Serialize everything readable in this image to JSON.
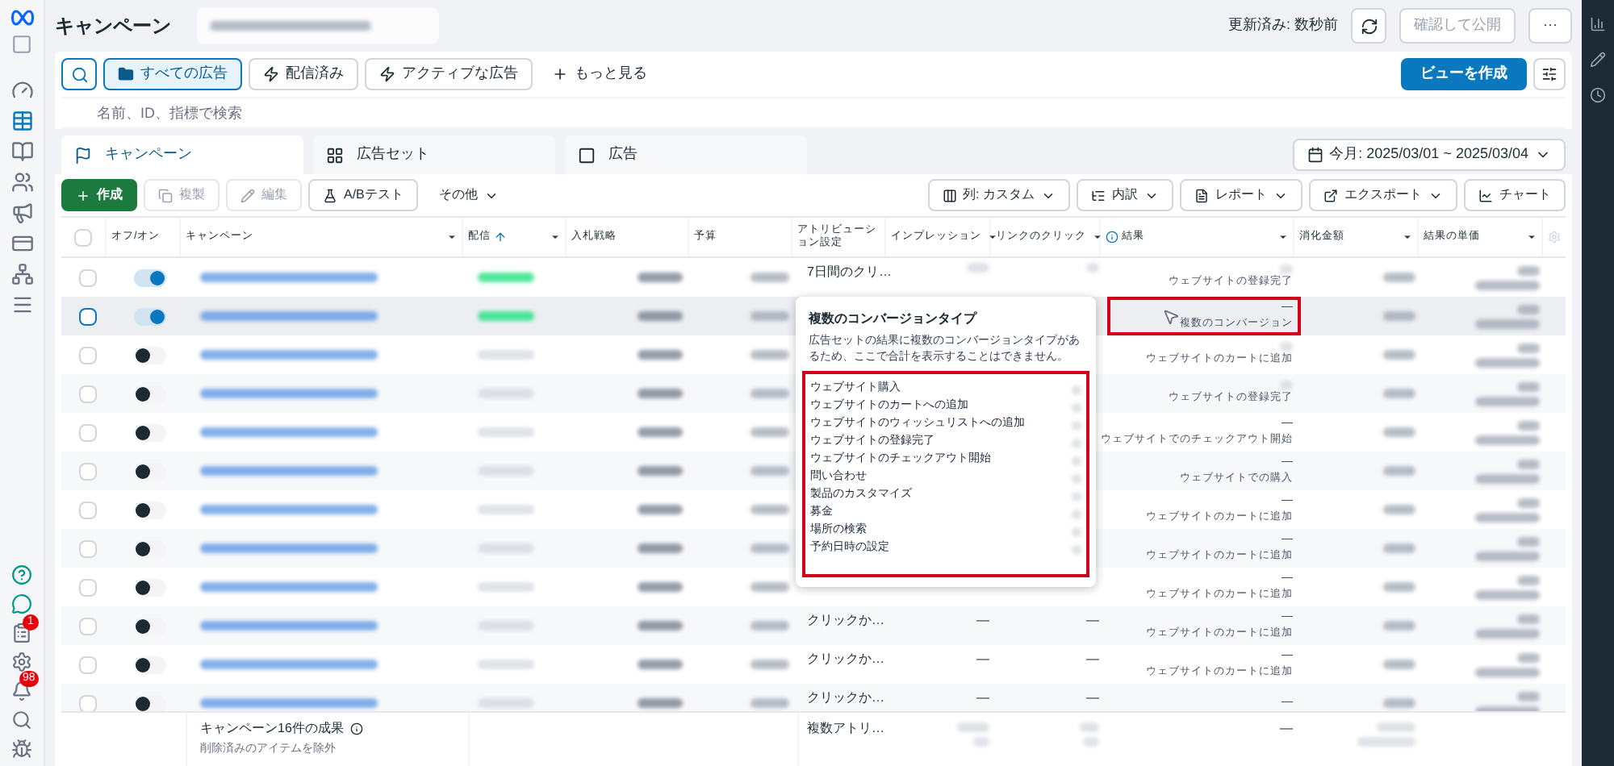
{
  "header": {
    "title": "キャンペーン",
    "updated": "更新済み: 数秒前",
    "publish_button": "確認して公開",
    "more_button": "···"
  },
  "filters": [
    {
      "label": "すべての広告",
      "selected": true,
      "kind": "folder"
    },
    {
      "label": "配信済み",
      "selected": false,
      "kind": "bolt"
    },
    {
      "label": "アクティブな広告",
      "selected": false,
      "kind": "bolt"
    }
  ],
  "more_filters": "もっと見る",
  "create_view": "ビューを作成",
  "search": {
    "placeholder": "名前、ID、指標で検索"
  },
  "tabs": [
    {
      "label": "キャンペーン",
      "selected": true,
      "kind": "campaign"
    },
    {
      "label": "広告セット",
      "selected": false,
      "kind": "adset"
    },
    {
      "label": "広告",
      "selected": false,
      "kind": "ad"
    }
  ],
  "date_range": "今月: 2025/03/01 ~ 2025/03/04",
  "toolbar_left": [
    {
      "label": "作成",
      "kind": "create",
      "disabled": false
    },
    {
      "label": "複製",
      "kind": "duplicate",
      "disabled": true
    },
    {
      "label": "編集",
      "kind": "edit",
      "disabled": true
    },
    {
      "label": "A/Bテスト",
      "kind": "abtest",
      "disabled": false
    },
    {
      "label": "その他",
      "kind": "other",
      "disabled": false
    }
  ],
  "toolbar_right": [
    {
      "label": "列: カスタム",
      "kind": "columns"
    },
    {
      "label": "内訳",
      "kind": "breakdown"
    },
    {
      "label": "レポート",
      "kind": "reports"
    },
    {
      "label": "エクスポート",
      "kind": "export"
    },
    {
      "label": "チャート",
      "kind": "chart"
    }
  ],
  "all_checked": false,
  "columns": [
    {
      "label": "オフ/オン",
      "dropdown": false,
      "sorted": false,
      "info": false
    },
    {
      "label": "キャンペーン",
      "dropdown": true,
      "sorted": false,
      "info": false
    },
    {
      "label": "配信",
      "dropdown": true,
      "sorted": true,
      "info": false
    },
    {
      "label": "入札戦略",
      "dropdown": false,
      "sorted": false,
      "info": false
    },
    {
      "label": "予算",
      "dropdown": false,
      "sorted": false,
      "info": false
    },
    {
      "label": "アトリビューション設定",
      "dropdown": false,
      "sorted": false,
      "info": false
    },
    {
      "label": "インプレッション",
      "dropdown": true,
      "sorted": false,
      "info": false
    },
    {
      "label": "リンクのクリック",
      "dropdown": true,
      "sorted": false,
      "info": false
    },
    {
      "label": "結果",
      "dropdown": true,
      "sorted": false,
      "info": true
    },
    {
      "label": "消化金額",
      "dropdown": true,
      "sorted": false,
      "info": false
    },
    {
      "label": "結果の単価",
      "dropdown": true,
      "sorted": false,
      "info": false
    }
  ],
  "rows": [
    {
      "checked": false,
      "on": true,
      "attribution": "7日間のクリ…",
      "result_type": "ウェブサイトの登録完了",
      "highlighted": false
    },
    {
      "checked": false,
      "on": true,
      "result": "—",
      "result_type": "複数のコンバージョン",
      "highlighted": true
    },
    {
      "checked": false,
      "on": false,
      "result_type": "ウェブサイトのカートに追加",
      "highlighted": false
    },
    {
      "checked": false,
      "on": false,
      "result_type": "ウェブサイトの登録完了",
      "highlighted": false
    },
    {
      "checked": false,
      "on": false,
      "result": "—",
      "result_type": "ウェブサイトでのチェックアウト開始",
      "highlighted": false
    },
    {
      "checked": false,
      "on": false,
      "result": "—",
      "result_type": "ウェブサイトでの購入",
      "highlighted": false
    },
    {
      "checked": false,
      "on": false,
      "result": "—",
      "result_type": "ウェブサイトのカートに追加",
      "highlighted": false
    },
    {
      "checked": false,
      "on": false,
      "result": "—",
      "result_type": "ウェブサイトのカートに追加",
      "highlighted": false
    },
    {
      "checked": false,
      "on": false,
      "result": "—",
      "result_type": "ウェブサイトのカートに追加",
      "highlighted": false
    },
    {
      "checked": false,
      "on": false,
      "attribution": "クリックか…",
      "impressions": "—",
      "clicks": "—",
      "result": "—",
      "result_type": "ウェブサイトのカートに追加",
      "highlighted": false
    },
    {
      "checked": false,
      "on": false,
      "attribution": "クリックか…",
      "impressions": "—",
      "clicks": "—",
      "result": "—",
      "result_type": "ウェブサイトのカートに追加",
      "highlighted": false
    },
    {
      "checked": false,
      "on": false,
      "attribution": "クリックか…",
      "impressions": "—",
      "clicks": "—",
      "result": "—",
      "highlighted": false
    }
  ],
  "footer": {
    "title": "キャンペーン16件の成果",
    "note": "削除済みのアイテムを除外",
    "attribution": "複数アトリ…",
    "result": "—"
  },
  "tooltip": {
    "title": "複数のコンバージョンタイプ",
    "text": "広告セットの結果に複数のコンバージョンタイプがあるため、ここで合計を表示することはできません。",
    "items": [
      "ウェブサイト購入",
      "ウェブサイトのカートへの追加",
      "ウェブサイトのウィッシュリストへの追加",
      "ウェブサイトの登録完了",
      "ウェブサイトのチェックアウト開始",
      "問い合わせ",
      "製品のカスタマイズ",
      "募金",
      "場所の検索",
      "予約日時の設定"
    ]
  },
  "sidebar_badges": {
    "notices": "1",
    "notifications": "98"
  }
}
